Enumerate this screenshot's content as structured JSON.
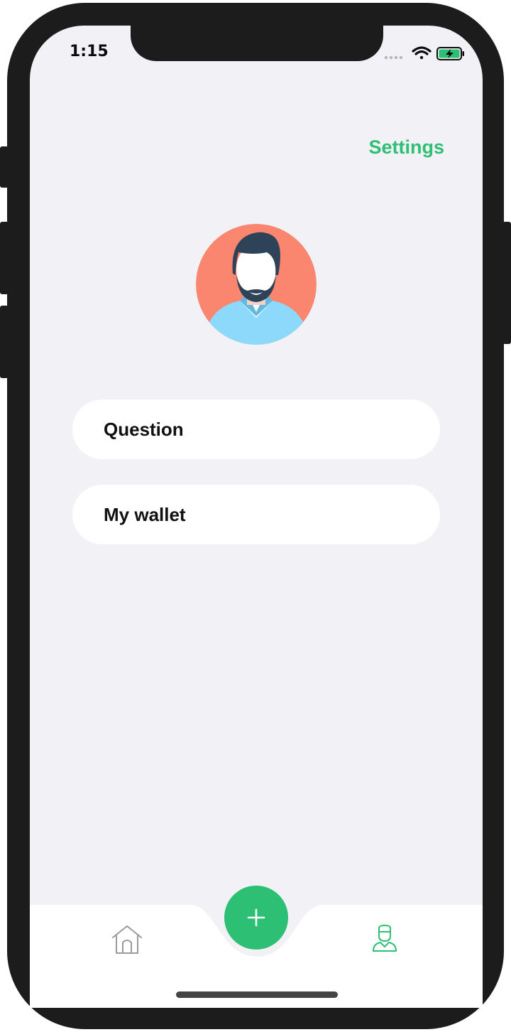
{
  "status_bar": {
    "time": "1:15",
    "icons": [
      "signal-dots-icon",
      "wifi-icon",
      "battery-charging-icon"
    ]
  },
  "header": {
    "settings_label": "Settings"
  },
  "profile": {
    "avatar": "user-avatar-bearded-man"
  },
  "menu": {
    "items": [
      {
        "label": "Question"
      },
      {
        "label": "My wallet"
      }
    ]
  },
  "tab_bar": {
    "tabs": [
      {
        "icon": "home-icon",
        "active": false
      },
      {
        "icon": "add-icon",
        "active": false
      },
      {
        "icon": "profile-icon",
        "active": true
      }
    ]
  },
  "colors": {
    "accent": "#2dbf73",
    "background": "#f2f1f6",
    "card": "#ffffff",
    "avatar_bg": "#fa8670",
    "shirt": "#8cd9fb",
    "hair": "#2f4358"
  }
}
